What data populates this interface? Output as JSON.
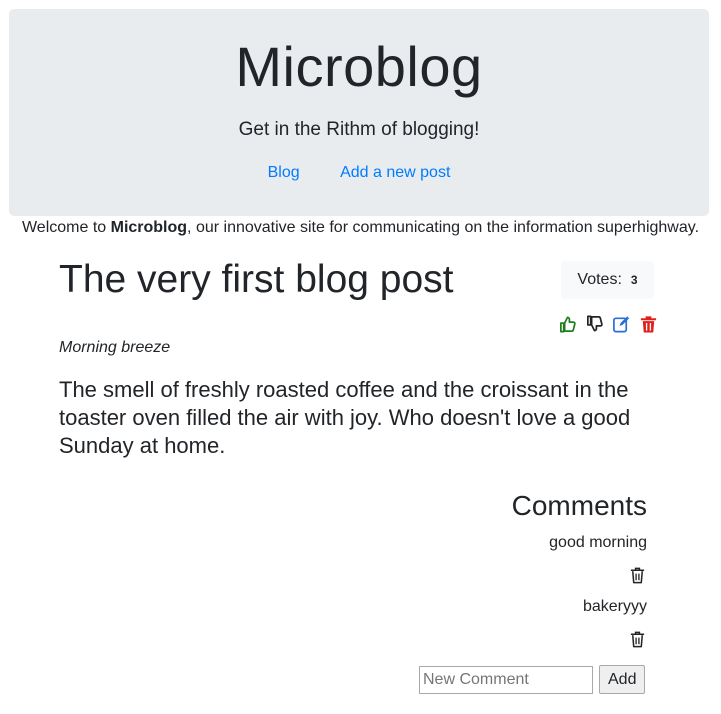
{
  "header": {
    "title": "Microblog",
    "tagline": "Get in the Rithm of blogging!",
    "nav": {
      "blog": "Blog",
      "add_post": "Add a new post"
    }
  },
  "welcome": {
    "prefix": "Welcome to ",
    "brand": "Microblog",
    "suffix": ", our innovative site for communicating on the information superhighway."
  },
  "post": {
    "title": "The very first blog post",
    "votes_label": "Votes:",
    "votes_count": "3",
    "subtitle": "Morning breeze",
    "body": "The smell of freshly roasted coffee and the croissant in the toaster oven filled the air with joy. Who doesn't love a good Sunday at home.",
    "icons": {
      "upvote": "thumbs-up-icon",
      "downvote": "thumbs-down-icon",
      "edit": "edit-icon",
      "delete": "trash-icon"
    },
    "colors": {
      "upvote": "#1e7e1e",
      "downvote": "#212529",
      "edit": "#2a6fd6",
      "delete": "#e0201c"
    }
  },
  "comments": {
    "title": "Comments",
    "items": [
      {
        "text": "good morning"
      },
      {
        "text": "bakeryyy"
      }
    ],
    "new_comment_placeholder": "New Comment",
    "add_label": "Add"
  },
  "theme": {
    "jumbotron_bg": "#e9ecef",
    "link": "#007bff",
    "votes_bg": "#f8f9fa"
  }
}
